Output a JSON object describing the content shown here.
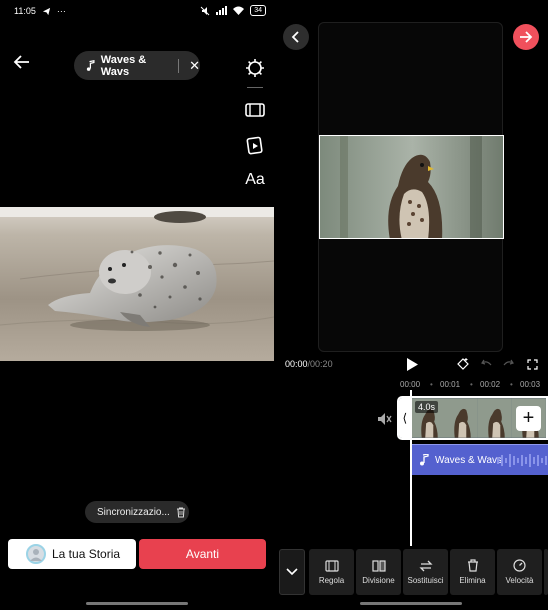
{
  "status": {
    "time": "11:05",
    "battery": "34"
  },
  "left": {
    "music_title": "Waves & Wavs",
    "sync_label": "Sincronizzazio...",
    "story_label": "La tua Storia",
    "next_label": "Avanti",
    "tools": [
      "settings-icon",
      "film-frame-icon",
      "clip-icon",
      "text-icon",
      "sticker-icon",
      "sparkle-icon",
      "filter-icon",
      "add-icon",
      "chevron-down-icon"
    ],
    "text_tool_label": "Aa"
  },
  "right": {
    "current_time": "00:00",
    "total_time": "00:20",
    "ticks": [
      "00:00",
      "00:01",
      "00:02",
      "00:03"
    ],
    "clip_duration": "4.0s",
    "audio_label": "Waves & Wavs",
    "actions": [
      "Regola",
      "Divisione",
      "Sostituisci",
      "Elimina",
      "Velocità"
    ]
  },
  "colors": {
    "accent": "#e8414f",
    "audio": "#5461cf"
  }
}
